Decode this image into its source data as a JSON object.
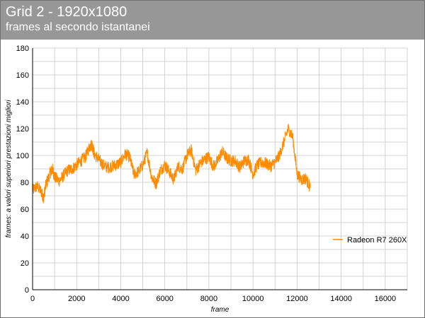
{
  "header": {
    "title": "Grid 2 - 1920x1080",
    "subtitle": "frames al secondo istantanei"
  },
  "colors": {
    "header_bg": "#979797",
    "series": "#ff8c00",
    "grid": "#c8c8c8",
    "axis": "#000000"
  },
  "chart_data": {
    "type": "line",
    "title": "Grid 2 - 1920x1080",
    "subtitle": "frames al secondo istantanei",
    "xlabel": "frame",
    "ylabel": "frames: a valori superiori prestazioni migliori",
    "xlim": [
      0,
      17000
    ],
    "ylim": [
      0,
      180
    ],
    "x_ticks": [
      0,
      2000,
      4000,
      6000,
      8000,
      10000,
      12000,
      14000,
      16000
    ],
    "y_ticks": [
      0,
      20,
      40,
      60,
      80,
      100,
      120,
      140,
      160,
      180
    ],
    "grid": true,
    "legend_position": "right",
    "series": [
      {
        "name": "Radeon R7 260X",
        "x": [
          0,
          200,
          400,
          500,
          600,
          800,
          900,
          1000,
          1200,
          1400,
          1600,
          1800,
          2000,
          2200,
          2400,
          2600,
          2700,
          2800,
          3000,
          3200,
          3400,
          3600,
          3800,
          4000,
          4200,
          4400,
          4600,
          4800,
          5000,
          5200,
          5400,
          5600,
          5800,
          6000,
          6200,
          6400,
          6600,
          6800,
          7000,
          7200,
          7400,
          7600,
          7800,
          8000,
          8200,
          8400,
          8600,
          8800,
          9000,
          9200,
          9400,
          9600,
          9800,
          10000,
          10200,
          10400,
          10600,
          10800,
          11000,
          11200,
          11400,
          11600,
          11800,
          12000,
          12200,
          12400,
          12600
        ],
        "values": [
          74,
          77,
          73,
          68,
          78,
          87,
          90,
          84,
          81,
          85,
          89,
          90,
          93,
          96,
          99,
          107,
          108,
          101,
          97,
          93,
          91,
          92,
          93,
          95,
          101,
          99,
          86,
          88,
          93,
          102,
          84,
          79,
          89,
          93,
          88,
          82,
          92,
          90,
          100,
          104,
          89,
          94,
          97,
          99,
          92,
          96,
          103,
          98,
          96,
          96,
          91,
          96,
          97,
          86,
          93,
          95,
          94,
          92,
          95,
          100,
          110,
          120,
          114,
          86,
          82,
          83,
          76
        ]
      }
    ]
  }
}
